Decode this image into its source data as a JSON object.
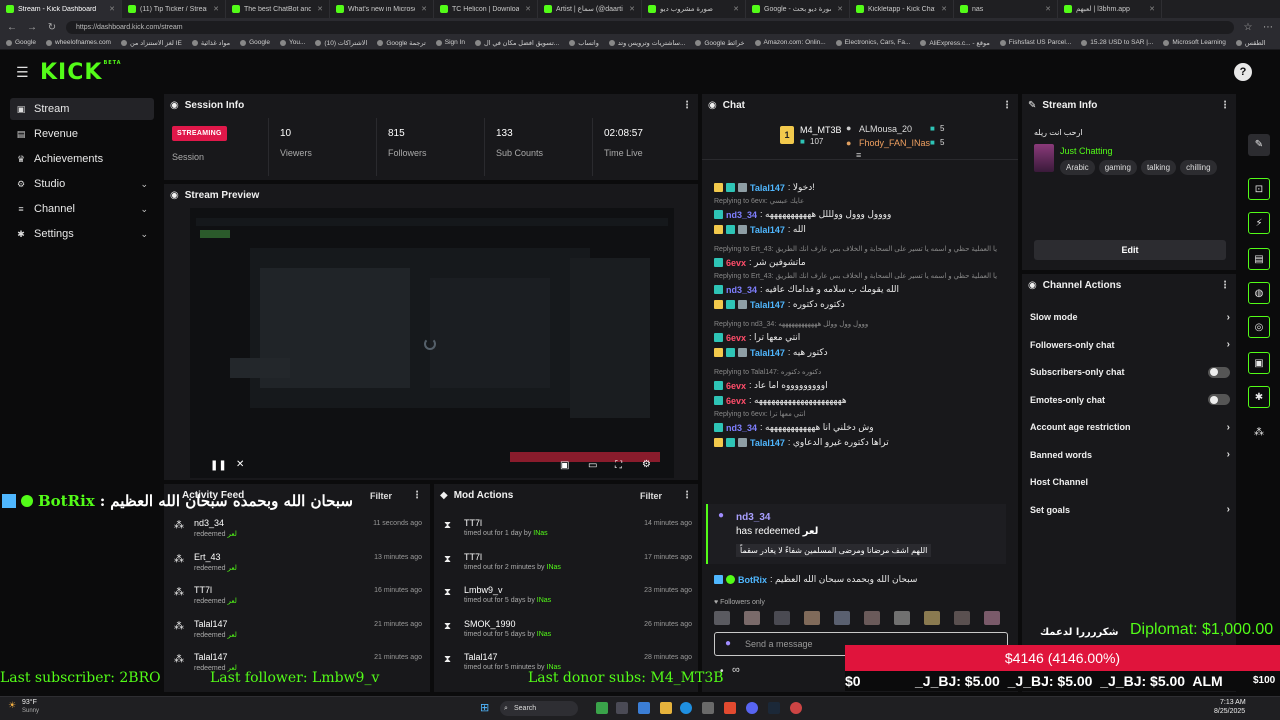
{
  "browser": {
    "tabs": [
      {
        "label": "Stream - Kick Dashboard",
        "active": true
      },
      {
        "label": "(11) Tip Ticker / Streamlabs"
      },
      {
        "label": "The best ChatBot and Widg"
      },
      {
        "label": "What's new in Microsoft Edi"
      },
      {
        "label": "TC Helicon | Downloads"
      },
      {
        "label": "Artist | سماع (@daartist33)"
      },
      {
        "label": "صورة مشروب ديو"
      },
      {
        "label": "Google - صورة ديو بحث"
      },
      {
        "label": "Kickletapp - Kick Chatbot"
      },
      {
        "label": "nas"
      },
      {
        "label": "لعبهم | l3bhm.app"
      }
    ],
    "url": "https://dashboard.kick.com/stream",
    "bookmarks": [
      "Google",
      "wheelofnames.com",
      "لغز الاستنزاد من IE",
      "مواد غذائية",
      "Google",
      "You...",
      "الاشتراكات (10)",
      "Google ترجمة",
      "Sign In",
      "تسويق افضل مكان في ال...",
      "واتساب",
      "ساشتريات وترويس وتد...",
      "Google خرائط",
      "Amazon.com: Onlin...",
      "Electronics, Cars, Fa...",
      "AliExpress.c... - موقع",
      "Fishsfast US Parcel...",
      "15.28 USD to SAR |...",
      "Microsoft Learning",
      "الطقس"
    ]
  },
  "header": {
    "logo": "KICK",
    "logo_tag": "BETA",
    "avatar_glyph": "?"
  },
  "sidebar": {
    "items": [
      {
        "label": "Stream",
        "icon": "camera-icon",
        "glyph": "▣"
      },
      {
        "label": "Revenue",
        "icon": "wallet-icon",
        "glyph": "▤"
      },
      {
        "label": "Achievements",
        "icon": "trophy-icon",
        "glyph": "♛"
      },
      {
        "label": "Studio",
        "icon": "palette-icon",
        "glyph": "⚙"
      },
      {
        "label": "Channel",
        "icon": "list-icon",
        "glyph": "≡"
      },
      {
        "label": "Settings",
        "icon": "gear-icon",
        "glyph": "✱"
      }
    ],
    "chevron": "⌄"
  },
  "session": {
    "title": "Session Info",
    "badge": "STREAMING",
    "badge_label": "Session",
    "stats": [
      {
        "value": "10",
        "label": "Viewers"
      },
      {
        "value": "815",
        "label": "Followers"
      },
      {
        "value": "133",
        "label": "Sub Counts"
      },
      {
        "value": "02:08:57",
        "label": "Time Live"
      }
    ]
  },
  "preview": {
    "title": "Stream Preview"
  },
  "activity": {
    "title": "Activity Feed",
    "filter": "Filter",
    "rows": [
      {
        "name": "nd3_34",
        "sub": "redeemed",
        "reward": "لعر",
        "time": "11 seconds ago"
      },
      {
        "name": "Ert_43",
        "sub": "redeemed",
        "reward": "لعر",
        "time": "13 minutes ago"
      },
      {
        "name": "TT7l",
        "sub": "redeemed",
        "reward": "لعر",
        "time": "16 minutes ago"
      },
      {
        "name": "Talal147",
        "sub": "redeemed",
        "reward": "لعر",
        "time": "21 minutes ago"
      },
      {
        "name": "Talal147",
        "sub": "redeemed",
        "reward": "لعر",
        "time": "21 minutes ago"
      }
    ]
  },
  "mod": {
    "title": "Mod Actions",
    "filter": "Filter",
    "rows": [
      {
        "name": "TT7l",
        "sub": "timed out for 1 day by",
        "by": "INas",
        "time": "14 minutes ago"
      },
      {
        "name": "TT7l",
        "sub": "timed out for 2 minutes by",
        "by": "INas",
        "time": "17 minutes ago"
      },
      {
        "name": "Lmbw9_v",
        "sub": "timed out for 5 days by",
        "by": "INas",
        "time": "23 minutes ago"
      },
      {
        "name": "SMOK_1990",
        "sub": "timed out for 5 days by",
        "by": "INas",
        "time": "26 minutes ago"
      },
      {
        "name": "Talal147",
        "sub": "timed out for 5 minutes by",
        "by": "INas",
        "time": "28 minutes ago"
      }
    ]
  },
  "chat": {
    "title": "Chat",
    "top": {
      "rank1_name": "M4_MT3B",
      "rank1_count": "107",
      "rank1_num": "1",
      "rank2_name": "ALMousa_20",
      "rank2_count": "5",
      "rank3_name": "Fhody_FAN_INas",
      "rank3_count": "5"
    },
    "messages": [
      {
        "kind": "msg",
        "user": "Talal147",
        "cls": "u-talal",
        "badges": [
          "b-crown",
          "b-sub",
          "b-gift"
        ],
        "text": ": دخولا!"
      },
      {
        "kind": "reply",
        "text": "Replying to 6evx: عايك عبسي"
      },
      {
        "kind": "msg",
        "user": "nd3_34",
        "cls": "u-nd",
        "badges": [
          "b-sub"
        ],
        "text": ": وووول ووول وولللل هههههههههههه"
      },
      {
        "kind": "msg",
        "user": "Talal147",
        "cls": "u-talal",
        "badges": [
          "b-crown",
          "b-sub",
          "b-gift"
        ],
        "text": ": الله"
      },
      {
        "kind": "reply",
        "text": "Replying to Ert_43: يا العملية حظي و اسمه يا تسير على السحابة و الخلاف بس عارف انك الطريق"
      },
      {
        "kind": "msg",
        "user": "6evx",
        "cls": "u-evx",
        "badges": [
          "b-sub"
        ],
        "text": ": ماتشوفين شر"
      },
      {
        "kind": "reply",
        "text": "Replying to Ert_43: يا العملية حظي و اسمه يا تسير على السحابة و الخلاف بس عارف انك الطريق"
      },
      {
        "kind": "msg",
        "user": "nd3_34",
        "cls": "u-nd",
        "badges": [
          "b-sub"
        ],
        "text": ": الله يقومك ب سلامه و فداماك عافيه"
      },
      {
        "kind": "msg",
        "user": "Talal147",
        "cls": "u-talal",
        "badges": [
          "b-crown",
          "b-sub",
          "b-gift"
        ],
        "text": ": دكتوره دكتوره"
      },
      {
        "kind": "reply",
        "text": "Replying to nd3_34: ووول وول وولل ههههههههههههه"
      },
      {
        "kind": "msg",
        "user": "6evx",
        "cls": "u-evx",
        "badges": [
          "b-sub"
        ],
        "text": ": انتي معها ترا"
      },
      {
        "kind": "msg",
        "user": "Talal147",
        "cls": "u-talal",
        "badges": [
          "b-crown",
          "b-sub",
          "b-gift"
        ],
        "text": ": دكتور هيه"
      },
      {
        "kind": "reply",
        "text": "Replying to Talal147: دكتوره دكتوره"
      },
      {
        "kind": "msg",
        "user": "6evx",
        "cls": "u-evx",
        "badges": [
          "b-sub"
        ],
        "text": ": اوووووووووه اما عاد"
      },
      {
        "kind": "msg",
        "user": "6evx",
        "cls": "u-evx",
        "badges": [
          "b-sub"
        ],
        "text": ": هههههههههههههههههههههه"
      },
      {
        "kind": "reply",
        "text": "Replying to 6evx: انتي معها ترا"
      },
      {
        "kind": "msg",
        "user": "nd3_34",
        "cls": "u-nd",
        "badges": [
          "b-sub"
        ],
        "text": ": وش دخلني انا ههههههههههههه"
      },
      {
        "kind": "msg",
        "user": "Talal147",
        "cls": "u-talal",
        "badges": [
          "b-crown",
          "b-sub",
          "b-gift"
        ],
        "text": ": تراها دكتوره غيرو الدعاوي"
      }
    ],
    "redeem": {
      "user": "nd3_34",
      "text": "has redeemed",
      "reward": "لعر",
      "message": "اللهم اشف مرضانا ومرضى المسلمين شفاءً لا يغادر سقماً"
    },
    "botrix": {
      "user": "BotRix",
      "text": ": سبحان الله وبحمده سبحان الله العظيم"
    },
    "followers_only": "Followers only",
    "input_placeholder": "Send a message",
    "send_glyph": "∞"
  },
  "streaminfo": {
    "title": "Stream Info",
    "stream_title": "ارحب انت ريله",
    "category": "Just Chatting",
    "tags": [
      "Arabic",
      "gaming",
      "talking",
      "chilling"
    ],
    "edit": "Edit"
  },
  "channel": {
    "title": "Channel Actions",
    "rows": [
      {
        "label": "Slow mode",
        "ctrl": "chev"
      },
      {
        "label": "Followers-only chat",
        "ctrl": "chev"
      },
      {
        "label": "Subscribers-only chat",
        "ctrl": "toggle"
      },
      {
        "label": "Emotes-only chat",
        "ctrl": "toggle"
      },
      {
        "label": "Account age restriction",
        "ctrl": "chev"
      },
      {
        "label": "Banned words",
        "ctrl": "chev"
      },
      {
        "label": "Host Channel",
        "ctrl": "none"
      },
      {
        "label": "Set goals",
        "ctrl": "chev"
      }
    ]
  },
  "overlays": {
    "botrix_user": "BotRix",
    "botrix_text": "سبحان الله وبحمده سبحان الله العظيم",
    "last_subscriber": "Last subscriber: 2BRO",
    "last_follower": "Last follower: Lmbw9_v",
    "last_donor": "Last donor subs: M4_MT3B",
    "diplomat": "Diplomat: $1,000.00",
    "thanks": "شكررررا لدعمك",
    "goal": "$4146 (4146.00%)",
    "ticker_zero": "$0",
    "ticker": "_J_BJ: $5.00  _J_BJ: $5.00  _J_BJ: $5.00  ALM",
    "ticker_end": "$100"
  },
  "taskbar": {
    "weather_temp": "93°F",
    "weather_label": "Sunny",
    "search": "Search",
    "time": "7:13 AM",
    "date": "8/25/2025"
  },
  "colors": {
    "kick_green": "#53fc18",
    "live_red": "#e0184a",
    "goal_red": "#e0143c"
  }
}
